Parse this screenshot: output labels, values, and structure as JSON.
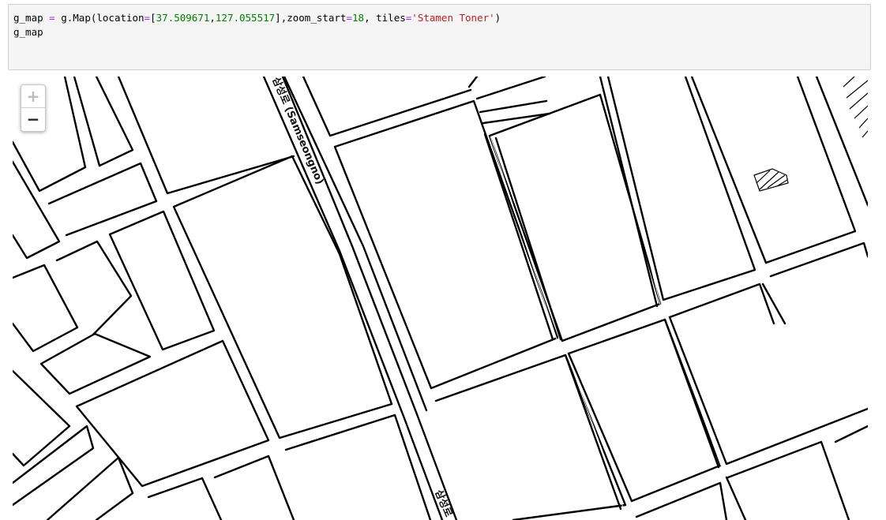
{
  "code_cell": {
    "line1": {
      "t1": "g_map ",
      "t2": "=",
      "t3": " g.Map(location",
      "t4": "=",
      "t5": "[",
      "t6": "37.509671",
      "t7": ",",
      "t8": "127.055517",
      "t9": "],zoom_start",
      "t10": "=",
      "t11": "18",
      "t12": ", tiles",
      "t13": "=",
      "t14": "'Stamen Toner'",
      "t15": ")"
    },
    "line2": "g_map"
  },
  "map": {
    "zoom_in_label": "+",
    "zoom_out_label": "−",
    "road_label_main": "삼성로 (Samseongno)",
    "road_label_bottom": "삼성로",
    "zoom_in_disabled": true,
    "icons": [
      "plus-icon",
      "minus-icon"
    ]
  }
}
